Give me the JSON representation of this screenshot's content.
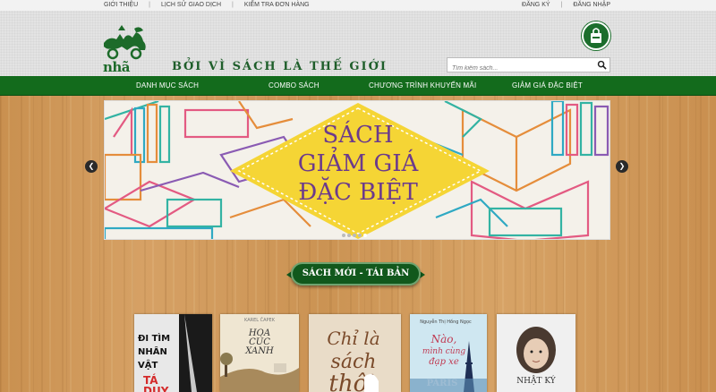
{
  "topbar": {
    "links": [
      "GIỚI THIỆU",
      "LỊCH SỬ GIAO DỊCH",
      "KIỂM TRA ĐƠN HÀNG"
    ],
    "account": [
      "ĐĂNG KÝ",
      "ĐĂNG NHẬP"
    ]
  },
  "header": {
    "brand": "nhã nam",
    "tagline": "BỞI VÌ SÁCH LÀ THẾ GIỚI",
    "search_placeholder": "Tìm kiếm sách..."
  },
  "nav": {
    "items": [
      "DANH MỤC SÁCH",
      "COMBO SÁCH",
      "CHƯƠNG TRÌNH KHUYẾN MÃI",
      "GIẢM GIÁ ĐẶC BIỆT"
    ]
  },
  "banner": {
    "line1": "SÁCH",
    "line2": "GIẢM GIÁ",
    "line3": "ĐẶC BIỆT",
    "slide_count": 5,
    "active_slide": 5
  },
  "section": {
    "title": "SÁCH MỚI - TÁI BẢN"
  },
  "books": [
    {
      "title": "ĐI TÌM NHÂN VẬT TÁ DUY"
    },
    {
      "author": "KAREL ČAPEK",
      "title": "HOA CÚC XANH"
    },
    {
      "title": "Chỉ là sách thôi"
    },
    {
      "title": "Nào, mình cùng đạp xe đến PARIS"
    },
    {
      "title": "NHẬT KÝ"
    }
  ],
  "colors": {
    "brand_green": "#136b1c",
    "banner_yellow": "#f5d535",
    "title_purple": "#6b3a8c"
  }
}
